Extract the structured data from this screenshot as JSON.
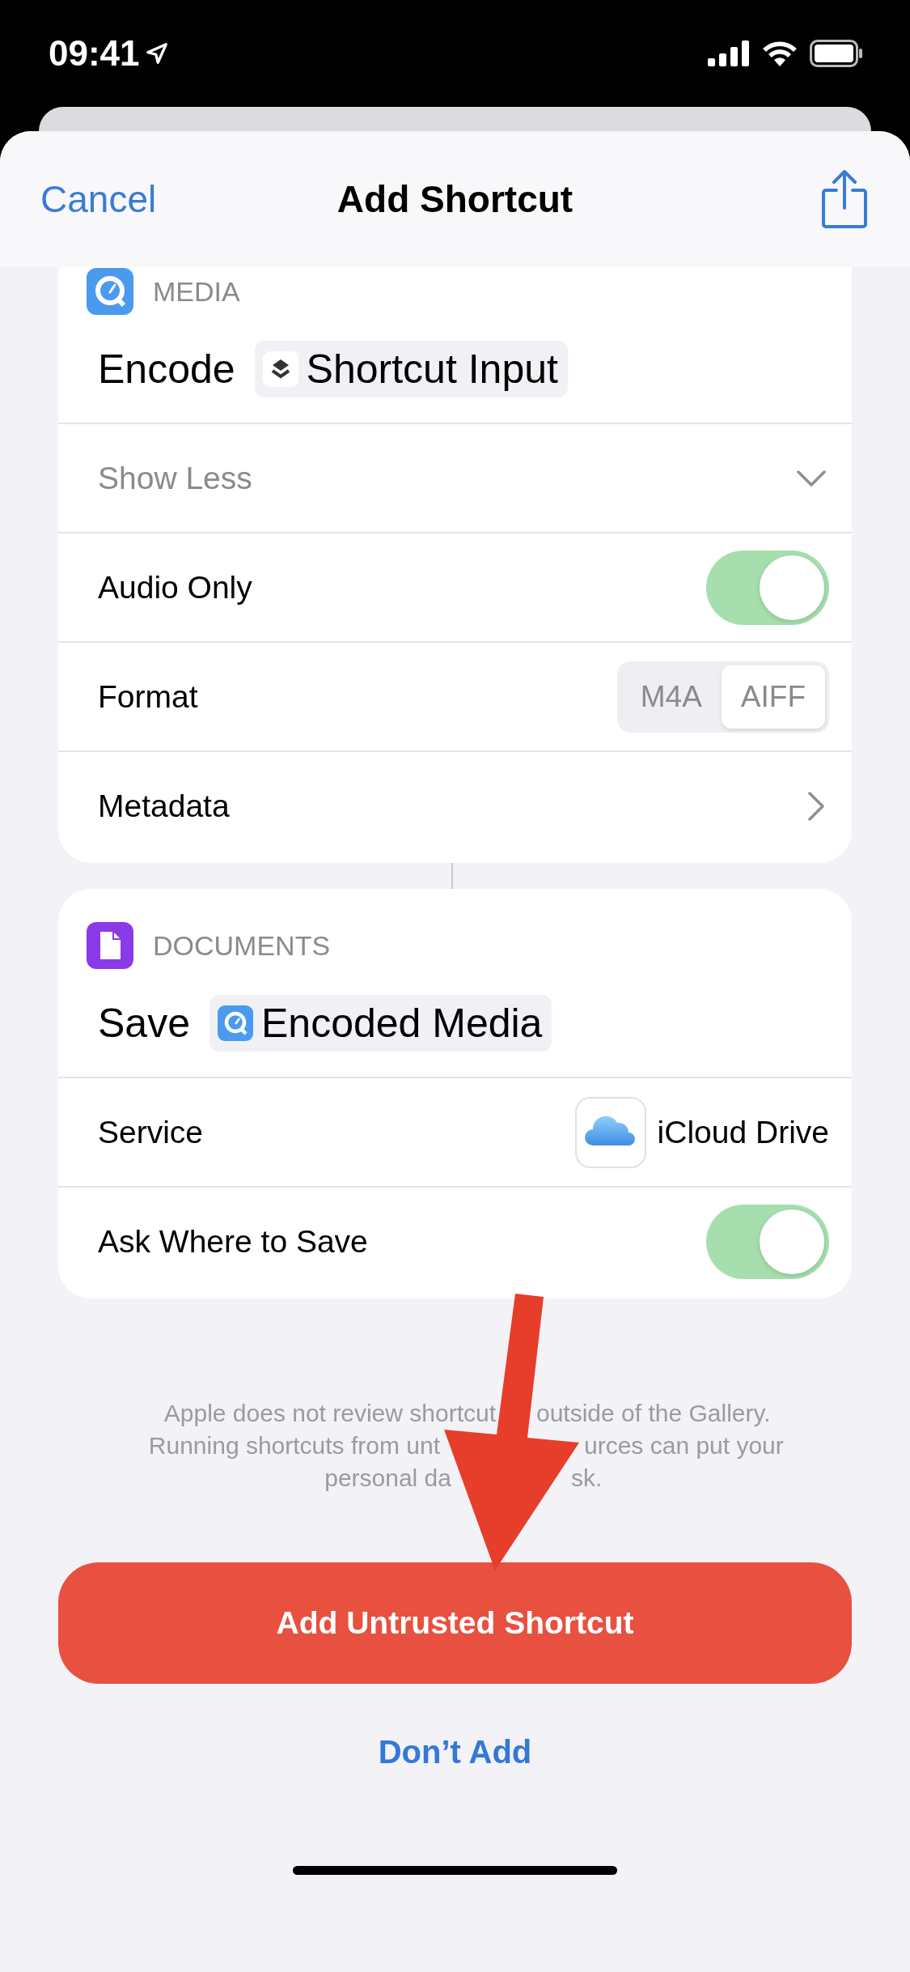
{
  "status_bar": {
    "time": "09:41"
  },
  "nav": {
    "cancel": "Cancel",
    "title": "Add Shortcut"
  },
  "actions": [
    {
      "kind": "media",
      "category": "MEDIA",
      "color": "#4a9af0",
      "verb": "Encode",
      "variable": {
        "kind": "shortcut",
        "text": "Shortcut Input"
      },
      "rows": [
        {
          "kind": "disclosure",
          "label": "Show Less",
          "expanded": true
        },
        {
          "kind": "toggle",
          "label": "Audio Only",
          "on": true
        },
        {
          "kind": "segmented",
          "label": "Format",
          "options": [
            {
              "label": "M4A",
              "selected": false
            },
            {
              "label": "AIFF",
              "selected": true
            }
          ]
        },
        {
          "kind": "link",
          "label": "Metadata"
        }
      ]
    },
    {
      "kind": "documents",
      "category": "DOCUMENTS",
      "color": "#8a3ae6",
      "verb": "Save",
      "variable": {
        "kind": "media",
        "text": "Encoded Media"
      },
      "rows": [
        {
          "kind": "value",
          "label": "Service",
          "value": "iCloud Drive"
        },
        {
          "kind": "toggle",
          "label": "Ask Where to Save",
          "on": true
        }
      ]
    }
  ],
  "warning": [
    [
      "Apple does not review shortcut",
      "outside of the Gallery."
    ],
    [
      "Running shortcuts from unt",
      "urces can put your"
    ],
    [
      "personal da",
      "sk."
    ]
  ],
  "primary_button": "Add Untrusted Shortcut",
  "secondary_button": "Don’t Add"
}
